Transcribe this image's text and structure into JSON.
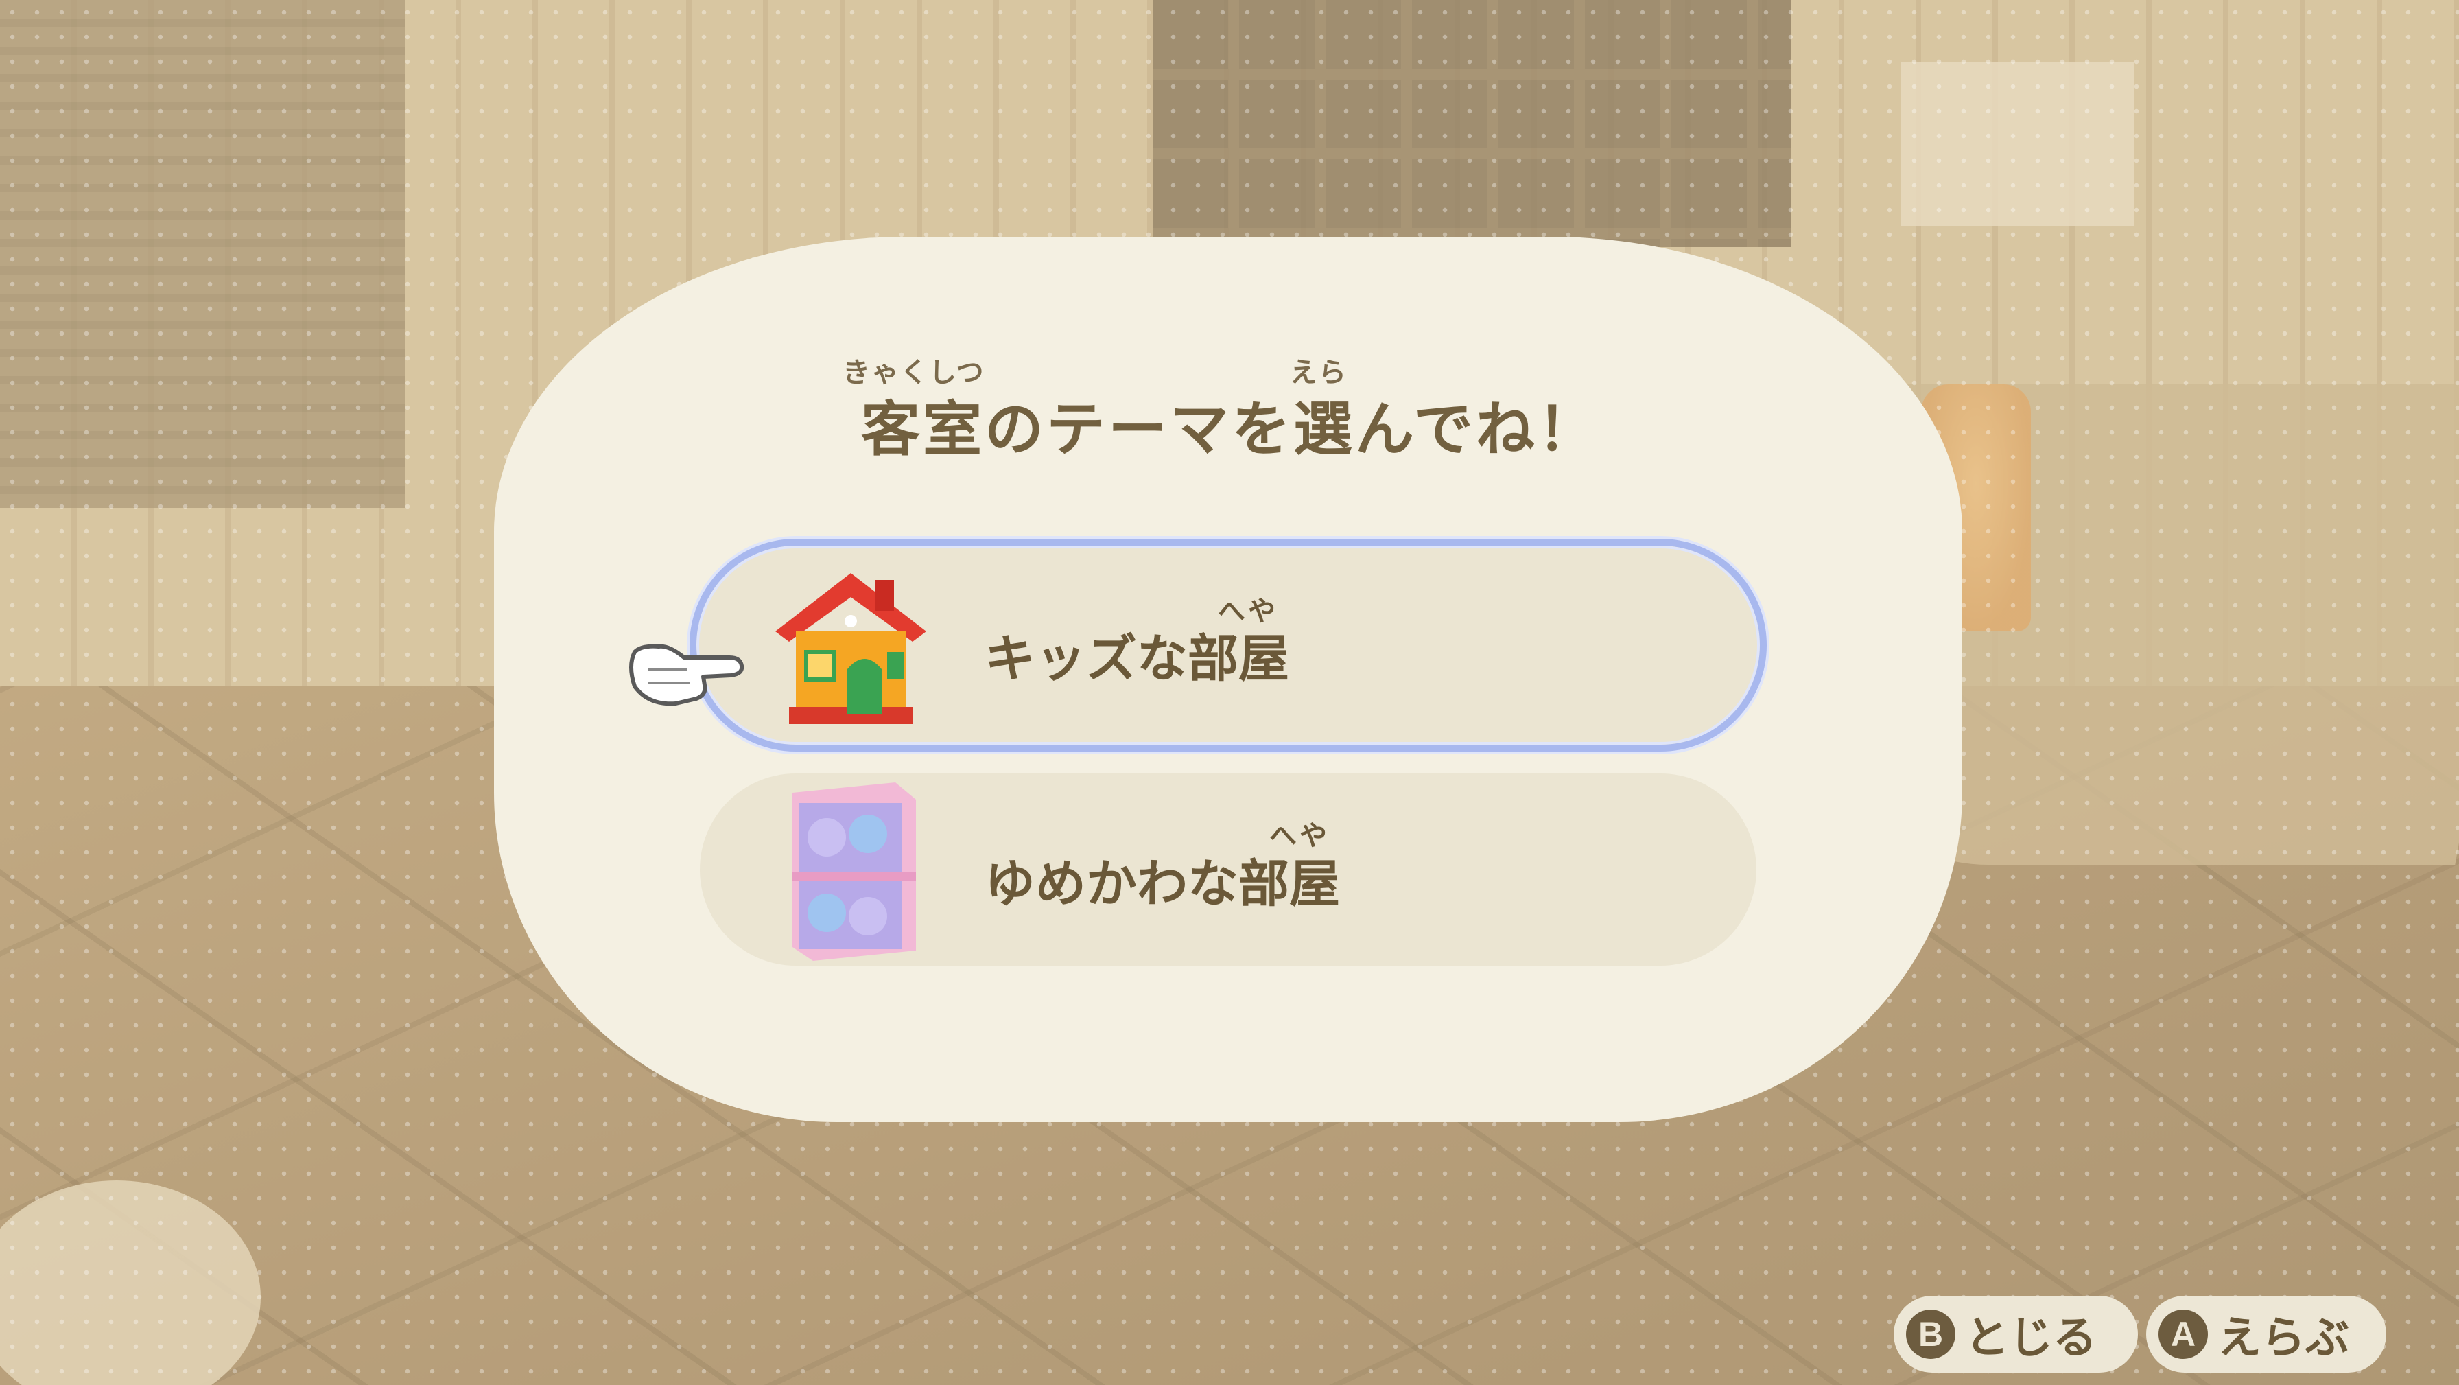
{
  "dialog": {
    "title": "客室のテーマを選んでね！",
    "title_ruby": [
      {
        "reading": "きゃくしつ",
        "base": "客室"
      },
      {
        "reading": "えら",
        "base": "選"
      }
    ]
  },
  "options": [
    {
      "label": "キッズな部屋",
      "ruby": "へや",
      "icon": "toy-house-icon",
      "selected": true
    },
    {
      "label": "ゆめかわな部屋",
      "ruby": "へや",
      "icon": "pastel-bear-shelf-icon",
      "selected": false
    }
  ],
  "controls": [
    {
      "button": "B",
      "label": "とじる"
    },
    {
      "button": "A",
      "label": "えらぶ"
    }
  ],
  "colors": {
    "dialog_bg": "#f4f0e2",
    "option_bg": "#ebe5d2",
    "selection_outline": "#a8b8ee",
    "text": "#72603f"
  }
}
